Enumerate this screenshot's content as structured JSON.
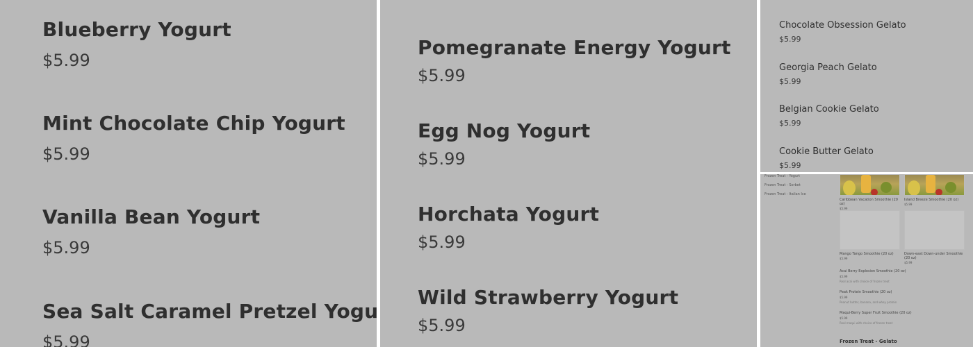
{
  "panel_a": {
    "items": [
      {
        "name": "Blueberry Yogurt",
        "price": "$5.99"
      },
      {
        "name": "Mint Chocolate Chip Yogurt",
        "price": "$5.99"
      },
      {
        "name": "Vanilla Bean Yogurt",
        "price": "$5.99"
      },
      {
        "name": "Sea Salt Caramel Pretzel Yogurt",
        "price": "$5.99"
      }
    ]
  },
  "panel_b": {
    "items": [
      {
        "name": "Pomegranate Energy Yogurt",
        "price": "$5.99"
      },
      {
        "name": "Egg Nog Yogurt",
        "price": "$5.99"
      },
      {
        "name": "Horchata Yogurt",
        "price": "$5.99"
      },
      {
        "name": "Wild Strawberry Yogurt",
        "price": "$5.99"
      }
    ]
  },
  "panel_c": {
    "items": [
      {
        "name": "Chocolate Obsession Gelato",
        "price": "$5.99"
      },
      {
        "name": "Georgia Peach Gelato",
        "price": "$5.99"
      },
      {
        "name": "Belgian Cookie Gelato",
        "price": "$5.99"
      },
      {
        "name": "Cookie Butter Gelato",
        "price": "$5.99"
      }
    ]
  },
  "panel_d": {
    "nav": [
      "Frozen Treat - Yogurt",
      "Frozen Treat - Sorbet",
      "Frozen Treat - Italian Ice"
    ],
    "cards": [
      {
        "name": "Caribbean Vacation Smoothie (20 oz)",
        "price": "$5.99",
        "image": "photo"
      },
      {
        "name": "Island Breeze Smoothie (20 oz)",
        "price": "$5.99",
        "image": "photo"
      },
      {
        "name": "Mango Tango Smoothie (20 oz)",
        "price": "$5.99",
        "image": "placeholder"
      },
      {
        "name": "Down-east Down-under Smoothie (20 oz)",
        "price": "$5.99",
        "image": "placeholder"
      }
    ],
    "list": [
      {
        "name": "Acai Berry Explosion Smoothie (20 oz)",
        "price": "$5.99",
        "desc": "Real acai with choice of frozen treat"
      },
      {
        "name": "Peak Protein Smoothie (20 oz)",
        "price": "$5.99",
        "desc": "Peanut butter, banana, and whey protein"
      },
      {
        "name": "Maqui-Berry Super Fruit Smoothie (20 oz)",
        "price": "$5.99",
        "desc": "Real maqui with choice of frozen treat"
      }
    ],
    "section_title": "Frozen Treat - Gelato"
  }
}
